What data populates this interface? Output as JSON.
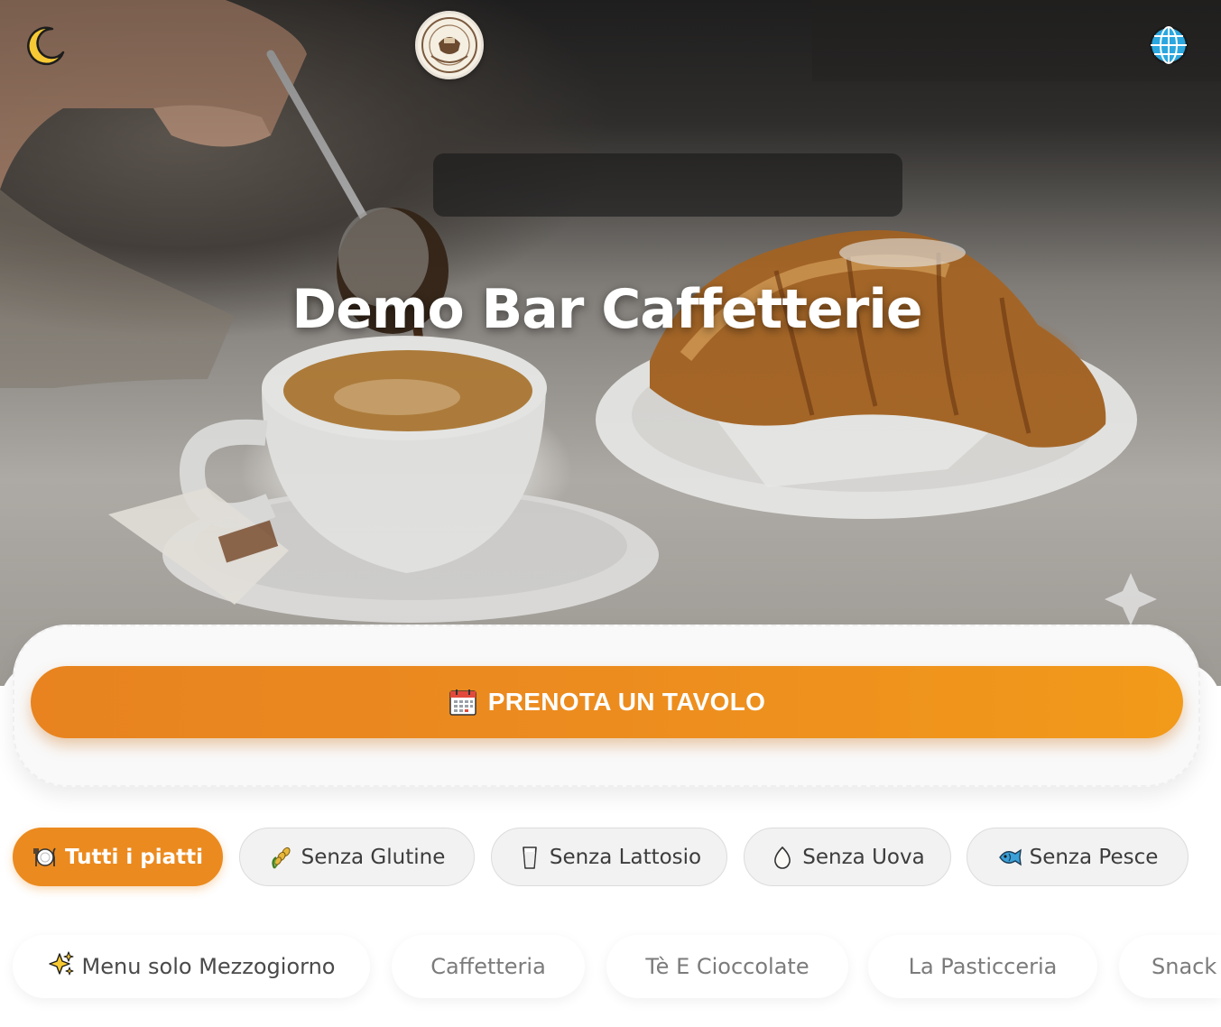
{
  "header": {
    "title": "Demo Bar Caffetterie",
    "theme_toggle_icon": "moon-icon",
    "language_icon": "globe-icon",
    "logo_icon": "cafe-logo"
  },
  "booking": {
    "icon": "calendar-icon",
    "label": "PRENOTA UN TAVOLO"
  },
  "filters": [
    {
      "label": "Tutti i piatti",
      "icon": "plate-cutlery-icon",
      "active": true
    },
    {
      "label": "Senza Glutine",
      "icon": "wheat-icon",
      "active": false
    },
    {
      "label": "Senza Lattosio",
      "icon": "milk-glass-icon",
      "active": false
    },
    {
      "label": "Senza Uova",
      "icon": "egg-icon",
      "active": false
    },
    {
      "label": "Senza Pesce",
      "icon": "fish-icon",
      "active": false
    }
  ],
  "categories": [
    {
      "label": "Menu solo Mezzogiorno",
      "icon": "sparkles-icon",
      "active": true
    },
    {
      "label": "Caffetteria",
      "active": false
    },
    {
      "label": "Tè E Cioccolate",
      "active": false
    },
    {
      "label": "La Pasticceria",
      "active": false
    },
    {
      "label": "Snack",
      "active": false
    }
  ],
  "colors": {
    "accent": "#EB8A1F",
    "chip_bg": "#F2F2F2",
    "hero_title": "#FFFFFF"
  }
}
